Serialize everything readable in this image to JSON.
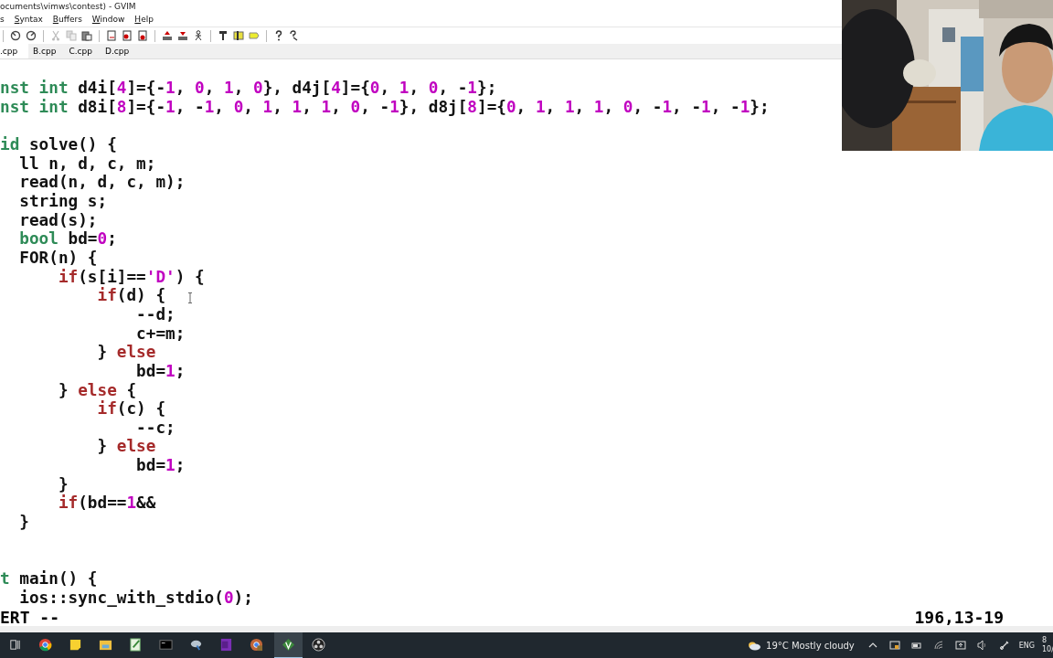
{
  "window": {
    "title": "ocuments\\vimws\\contest) - GVIM"
  },
  "menu": [
    {
      "label": "s",
      "mnemonic": false
    },
    {
      "label": "Syntax",
      "mnemonic": true
    },
    {
      "label": "Buffers",
      "mnemonic": true
    },
    {
      "label": "Window",
      "mnemonic": true
    },
    {
      "label": "Help",
      "mnemonic": true
    }
  ],
  "tabs": [
    {
      "label": ".cpp",
      "selected": true
    },
    {
      "label": "B.cpp",
      "selected": false
    },
    {
      "label": "C.cpp",
      "selected": false
    },
    {
      "label": "D.cpp",
      "selected": false
    }
  ],
  "code": [
    {
      "kind": "code",
      "segments": [
        {
          "t": "nst int",
          "kind": "type"
        },
        {
          "t": " d4i[",
          "kind": "plain"
        },
        {
          "t": "4",
          "kind": "number"
        },
        {
          "t": "]={-",
          "kind": "plain"
        },
        {
          "t": "1",
          "kind": "number"
        },
        {
          "t": ", ",
          "kind": "plain"
        },
        {
          "t": "0",
          "kind": "number"
        },
        {
          "t": ", ",
          "kind": "plain"
        },
        {
          "t": "1",
          "kind": "number"
        },
        {
          "t": ", ",
          "kind": "plain"
        },
        {
          "t": "0",
          "kind": "number"
        },
        {
          "t": "}, d4j[",
          "kind": "plain"
        },
        {
          "t": "4",
          "kind": "number"
        },
        {
          "t": "]={",
          "kind": "plain"
        },
        {
          "t": "0",
          "kind": "number"
        },
        {
          "t": ", ",
          "kind": "plain"
        },
        {
          "t": "1",
          "kind": "number"
        },
        {
          "t": ", ",
          "kind": "plain"
        },
        {
          "t": "0",
          "kind": "number"
        },
        {
          "t": ", -",
          "kind": "plain"
        },
        {
          "t": "1",
          "kind": "number"
        },
        {
          "t": "};",
          "kind": "plain"
        }
      ]
    },
    {
      "kind": "code",
      "segments": [
        {
          "t": "nst int",
          "kind": "type"
        },
        {
          "t": " d8i[",
          "kind": "plain"
        },
        {
          "t": "8",
          "kind": "number"
        },
        {
          "t": "]={-",
          "kind": "plain"
        },
        {
          "t": "1",
          "kind": "number"
        },
        {
          "t": ", -",
          "kind": "plain"
        },
        {
          "t": "1",
          "kind": "number"
        },
        {
          "t": ", ",
          "kind": "plain"
        },
        {
          "t": "0",
          "kind": "number"
        },
        {
          "t": ", ",
          "kind": "plain"
        },
        {
          "t": "1",
          "kind": "number"
        },
        {
          "t": ", ",
          "kind": "plain"
        },
        {
          "t": "1",
          "kind": "number"
        },
        {
          "t": ", ",
          "kind": "plain"
        },
        {
          "t": "1",
          "kind": "number"
        },
        {
          "t": ", ",
          "kind": "plain"
        },
        {
          "t": "0",
          "kind": "number"
        },
        {
          "t": ", -",
          "kind": "plain"
        },
        {
          "t": "1",
          "kind": "number"
        },
        {
          "t": "}, d8j[",
          "kind": "plain"
        },
        {
          "t": "8",
          "kind": "number"
        },
        {
          "t": "]={",
          "kind": "plain"
        },
        {
          "t": "0",
          "kind": "number"
        },
        {
          "t": ", ",
          "kind": "plain"
        },
        {
          "t": "1",
          "kind": "number"
        },
        {
          "t": ", ",
          "kind": "plain"
        },
        {
          "t": "1",
          "kind": "number"
        },
        {
          "t": ", ",
          "kind": "plain"
        },
        {
          "t": "1",
          "kind": "number"
        },
        {
          "t": ", ",
          "kind": "plain"
        },
        {
          "t": "0",
          "kind": "number"
        },
        {
          "t": ", -",
          "kind": "plain"
        },
        {
          "t": "1",
          "kind": "number"
        },
        {
          "t": ", -",
          "kind": "plain"
        },
        {
          "t": "1",
          "kind": "number"
        },
        {
          "t": ", -",
          "kind": "plain"
        },
        {
          "t": "1",
          "kind": "number"
        },
        {
          "t": "};",
          "kind": "plain"
        }
      ]
    },
    {
      "kind": "blank"
    },
    {
      "kind": "code",
      "segments": [
        {
          "t": "id",
          "kind": "type"
        },
        {
          "t": " solve() {",
          "kind": "plain"
        }
      ]
    },
    {
      "kind": "code",
      "segments": [
        {
          "t": "  ll n, d, c, m;",
          "kind": "plain"
        }
      ]
    },
    {
      "kind": "code",
      "segments": [
        {
          "t": "  read(n, d, c, m);",
          "kind": "plain"
        }
      ]
    },
    {
      "kind": "code",
      "segments": [
        {
          "t": "  string s;",
          "kind": "plain"
        }
      ]
    },
    {
      "kind": "code",
      "segments": [
        {
          "t": "  read(s);",
          "kind": "plain"
        }
      ]
    },
    {
      "kind": "code",
      "segments": [
        {
          "t": "  bool",
          "kind": "type"
        },
        {
          "t": " bd=",
          "kind": "plain"
        },
        {
          "t": "0",
          "kind": "number"
        },
        {
          "t": ";",
          "kind": "plain"
        }
      ]
    },
    {
      "kind": "code",
      "segments": [
        {
          "t": "  FOR(n) {",
          "kind": "plain"
        }
      ]
    },
    {
      "kind": "code",
      "segments": [
        {
          "t": "      if",
          "kind": "keyword"
        },
        {
          "t": "(s[i]==",
          "kind": "plain"
        },
        {
          "t": "'D'",
          "kind": "string"
        },
        {
          "t": ") {",
          "kind": "plain"
        }
      ]
    },
    {
      "kind": "code",
      "segments": [
        {
          "t": "          if",
          "kind": "keyword"
        },
        {
          "t": "(d) {",
          "kind": "plain"
        }
      ]
    },
    {
      "kind": "code",
      "segments": [
        {
          "t": "              --d;",
          "kind": "plain"
        }
      ]
    },
    {
      "kind": "code",
      "segments": [
        {
          "t": "              c+=m;",
          "kind": "plain"
        }
      ]
    },
    {
      "kind": "code",
      "segments": [
        {
          "t": "          } ",
          "kind": "plain"
        },
        {
          "t": "else",
          "kind": "keyword"
        }
      ]
    },
    {
      "kind": "code",
      "segments": [
        {
          "t": "              bd=",
          "kind": "plain"
        },
        {
          "t": "1",
          "kind": "number"
        },
        {
          "t": ";",
          "kind": "plain"
        }
      ]
    },
    {
      "kind": "code",
      "segments": [
        {
          "t": "      } ",
          "kind": "plain"
        },
        {
          "t": "else",
          "kind": "keyword"
        },
        {
          "t": " {",
          "kind": "plain"
        }
      ]
    },
    {
      "kind": "code",
      "segments": [
        {
          "t": "          if",
          "kind": "keyword"
        },
        {
          "t": "(c) {",
          "kind": "plain"
        }
      ]
    },
    {
      "kind": "code",
      "segments": [
        {
          "t": "              --c;",
          "kind": "plain"
        }
      ]
    },
    {
      "kind": "code",
      "segments": [
        {
          "t": "          } ",
          "kind": "plain"
        },
        {
          "t": "else",
          "kind": "keyword"
        }
      ]
    },
    {
      "kind": "code",
      "segments": [
        {
          "t": "              bd=",
          "kind": "plain"
        },
        {
          "t": "1",
          "kind": "number"
        },
        {
          "t": ";",
          "kind": "plain"
        }
      ]
    },
    {
      "kind": "code",
      "segments": [
        {
          "t": "      }",
          "kind": "plain"
        }
      ]
    },
    {
      "kind": "code",
      "segments": [
        {
          "t": "      if",
          "kind": "keyword"
        },
        {
          "t": "(bd==",
          "kind": "plain"
        },
        {
          "t": "1",
          "kind": "number"
        },
        {
          "t": "&&",
          "kind": "plain"
        }
      ]
    },
    {
      "kind": "code",
      "segments": [
        {
          "t": "  }",
          "kind": "plain"
        }
      ]
    },
    {
      "kind": "blank"
    },
    {
      "kind": "blank"
    },
    {
      "kind": "code",
      "segments": [
        {
          "t": "t",
          "kind": "type"
        },
        {
          "t": " main() {",
          "kind": "plain"
        }
      ]
    },
    {
      "kind": "code",
      "segments": [
        {
          "t": "  ios::sync_with_stdio(",
          "kind": "plain"
        },
        {
          "t": "0",
          "kind": "number"
        },
        {
          "t": ");",
          "kind": "plain"
        }
      ]
    }
  ],
  "status": {
    "mode": "ERT --",
    "position": "196,13-19"
  },
  "taskbar": {
    "weather": "19°C  Mostly cloudy",
    "language": "ENG",
    "time": "8",
    "date": "10/"
  }
}
